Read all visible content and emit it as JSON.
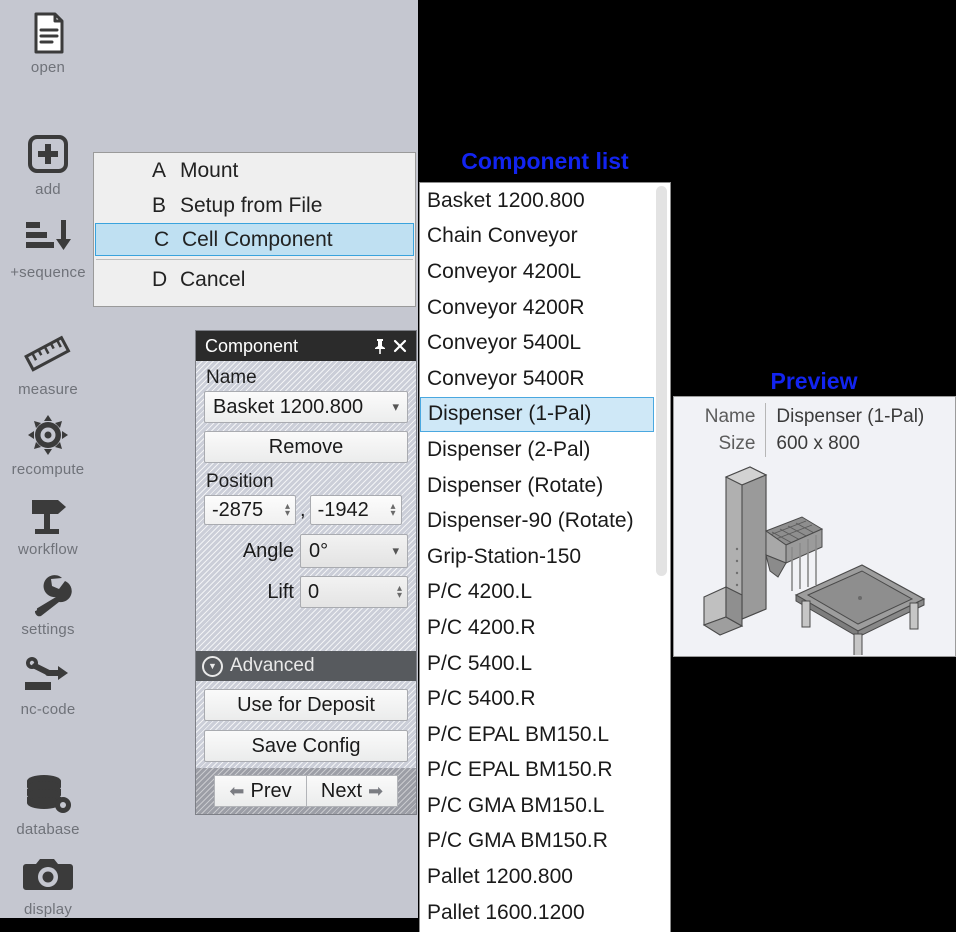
{
  "sidebar": {
    "items": [
      {
        "label": "open",
        "icon": "document-icon"
      },
      {
        "label": "add",
        "icon": "plus-box-icon"
      },
      {
        "label": "+sequence",
        "icon": "sequence-arrow-icon"
      },
      {
        "label": "measure",
        "icon": "ruler-icon"
      },
      {
        "label": "recompute",
        "icon": "gear-icon"
      },
      {
        "label": "workflow",
        "icon": "signpost-icon"
      },
      {
        "label": "settings",
        "icon": "wrench-icon"
      },
      {
        "label": "nc-code",
        "icon": "robot-arm-icon"
      },
      {
        "label": "database",
        "icon": "database-gear-icon"
      },
      {
        "label": "display",
        "icon": "camera-icon"
      }
    ]
  },
  "context_menu": {
    "items": [
      {
        "key": "A",
        "label": "Mount",
        "selected": false
      },
      {
        "key": "B",
        "label": "Setup from File",
        "selected": false
      },
      {
        "key": "C",
        "label": "Cell Component",
        "selected": true
      },
      {
        "key": "D",
        "label": "Cancel",
        "selected": false
      }
    ],
    "selected_highlight_color": "#bfe0f2",
    "selected_border_color": "#3aa3dd"
  },
  "component_panel": {
    "title": "Component",
    "pin_icon": "pin-icon",
    "close_icon": "close-icon",
    "name_label": "Name",
    "name_value": "Basket 1200.800",
    "remove_label": "Remove",
    "position_label": "Position",
    "position_x": "-2875",
    "position_separator": ",",
    "position_y": "-1942",
    "angle_label": "Angle",
    "angle_value": "0°",
    "lift_label": "Lift",
    "lift_value": "0",
    "advanced_label": "Advanced",
    "use_for_deposit_label": "Use for Deposit",
    "save_config_label": "Save Config",
    "prev_label": "Prev",
    "next_label": "Next"
  },
  "component_list": {
    "title": "Component list",
    "title_color": "#1224f0",
    "selected": "Dispenser (1-Pal)",
    "items": [
      "Basket 1200.800",
      "Chain Conveyor",
      "Conveyor 4200L",
      "Conveyor 4200R",
      "Conveyor 5400L",
      "Conveyor 5400R",
      "Dispenser (1-Pal)",
      "Dispenser (2-Pal)",
      "Dispenser (Rotate)",
      "Dispenser-90 (Rotate)",
      "Grip-Station-150",
      "P/C 4200.L",
      "P/C 4200.R",
      "P/C 5400.L",
      "P/C 5400.R",
      "P/C EPAL BM150.L",
      "P/C EPAL BM150.R",
      "P/C GMA BM150.L",
      "P/C GMA BM150.R",
      "Pallet 1200.800",
      "Pallet 1600.1200"
    ]
  },
  "preview": {
    "title": "Preview",
    "title_color": "#1224f0",
    "name_key": "Name",
    "name_value": "Dispenser (1-Pal)",
    "size_key": "Size",
    "size_value": "600 x 800",
    "model_icon": "3d-dispenser-model"
  }
}
